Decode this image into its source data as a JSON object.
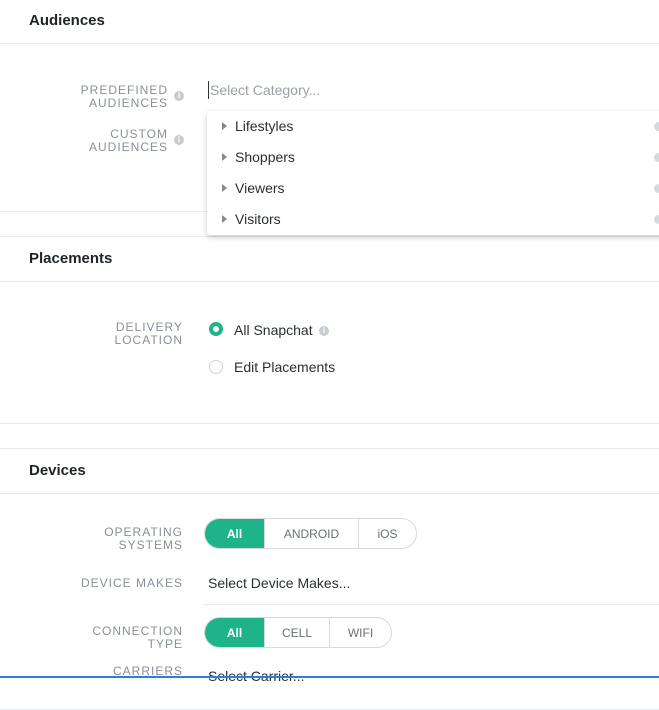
{
  "audiences": {
    "title": "Audiences",
    "predefined_label_1": "PREDEFINED",
    "predefined_label_2": "AUDIENCES",
    "predefined_placeholder": "Select Category...",
    "custom_label_1": "CUSTOM",
    "custom_label_2": "AUDIENCES",
    "dropdown": [
      "Lifestyles",
      "Shoppers",
      "Viewers",
      "Visitors"
    ]
  },
  "placements": {
    "title": "Placements",
    "delivery_label_1": "DELIVERY",
    "delivery_label_2": "LOCATION",
    "options": [
      {
        "label": "All Snapchat",
        "selected": true
      },
      {
        "label": "Edit Placements",
        "selected": false
      }
    ]
  },
  "devices": {
    "title": "Devices",
    "os_label_1": "OPERATING",
    "os_label_2": "SYSTEMS",
    "os_options": [
      "All",
      "ANDROID",
      "iOS"
    ],
    "os_active": "All",
    "makes_label": "DEVICE MAKES",
    "makes_value": "Select Device Makes...",
    "conn_label_1": "CONNECTION",
    "conn_label_2": "TYPE",
    "conn_options": [
      "All",
      "CELL",
      "WIFI"
    ],
    "conn_active": "All",
    "carriers_label": "CARRIERS",
    "carriers_value": "Select Carrier..."
  },
  "colors": {
    "accent": "#1fb38a",
    "border": "#e6e8ea",
    "label": "#8a9099"
  }
}
